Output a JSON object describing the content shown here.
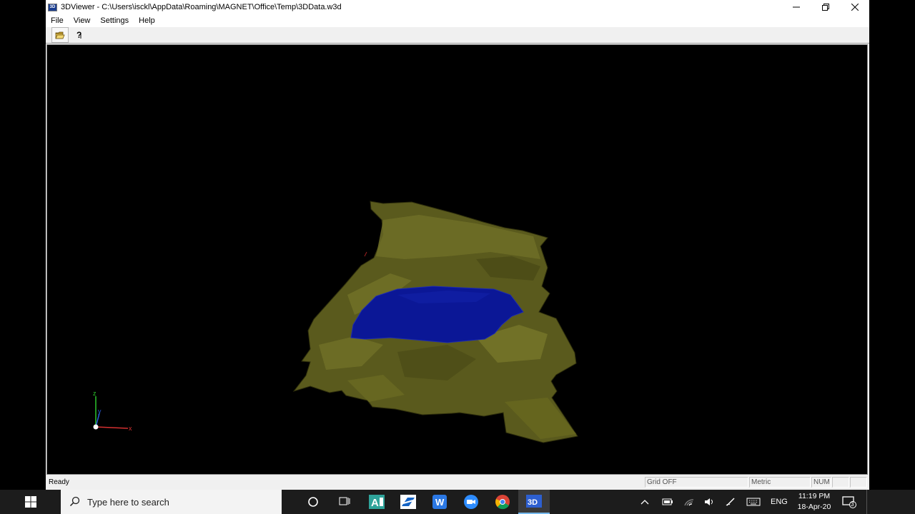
{
  "window": {
    "title": "3DViewer - C:\\Users\\isckl\\AppData\\Roaming\\MAGNET\\Office\\Temp\\3DData.w3d",
    "app_icon_text": "3D"
  },
  "menu": [
    "File",
    "View",
    "Settings",
    "Help"
  ],
  "toolbar": {
    "open_icon": "open-folder-icon",
    "help_icon": "help-pointer-icon"
  },
  "axes": {
    "z": "z",
    "y": "y",
    "x": "x"
  },
  "status": {
    "ready": "Ready",
    "grid": "Grid   OFF",
    "units": "Metric",
    "num": "NUM"
  },
  "taskbar": {
    "search_placeholder": "Type here to search",
    "lang": "ENG",
    "time": "11:19 PM",
    "date": "18-Apr-20",
    "notification_count": "3"
  },
  "colors": {
    "terrain": "#5e5e1c",
    "terrain_light": "#7a7a2a",
    "water": "#0a1a9a",
    "accent": "#0078d7"
  }
}
